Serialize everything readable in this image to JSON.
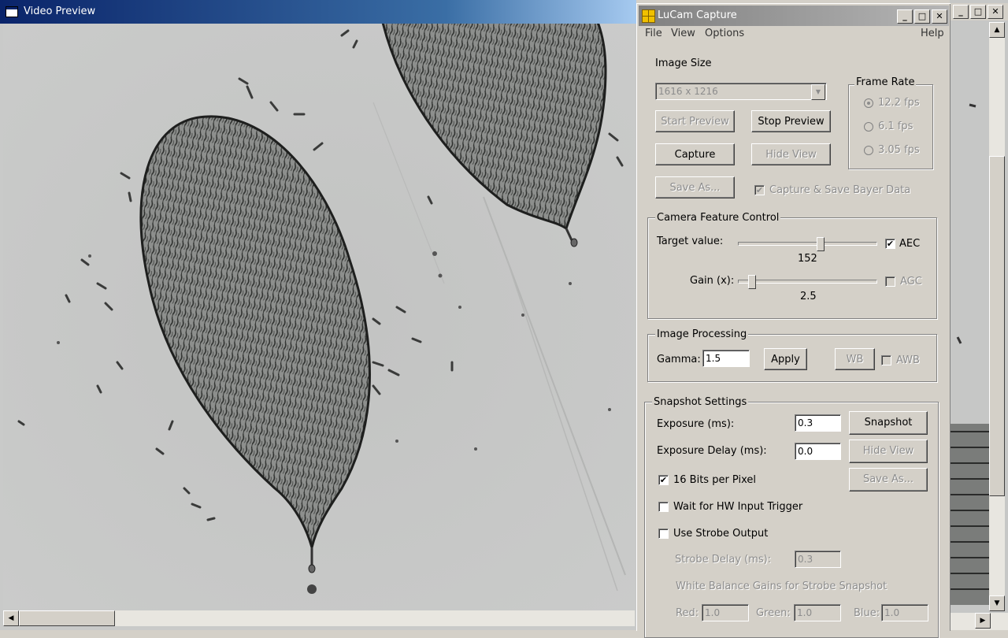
{
  "preview": {
    "title": "Video Preview"
  },
  "lucam": {
    "title": "LuCam Capture",
    "menu": {
      "file": "File",
      "view": "View",
      "options": "Options",
      "help": "Help"
    },
    "image_size": {
      "label": "Image Size",
      "selected": "1616 x 1216"
    },
    "frame_rate": {
      "title": "Frame Rate",
      "options": [
        "12.2 fps",
        "6.1 fps",
        "3.05 fps"
      ],
      "selected_index": 0
    },
    "buttons": {
      "start_preview": "Start Preview",
      "stop_preview": "Stop Preview",
      "capture": "Capture",
      "hide_view": "Hide View",
      "save_as": "Save As..."
    },
    "bayer": {
      "label": "Capture & Save Bayer Data",
      "checked": true
    },
    "camera_feature": {
      "title": "Camera Feature Control",
      "target_label": "Target value:",
      "target_value": "152",
      "target_fraction": 0.6,
      "aec_label": "AEC",
      "aec_checked": true,
      "gain_label": "Gain (x):",
      "gain_value": "2.5",
      "gain_fraction": 0.08,
      "agc_label": "AGC",
      "agc_checked": false
    },
    "image_processing": {
      "title": "Image Processing",
      "gamma_label": "Gamma:",
      "gamma_value": "1.5",
      "apply_label": "Apply",
      "wb_label": "WB",
      "awb_label": "AWB"
    },
    "snapshot": {
      "title": "Snapshot Settings",
      "exposure_label": "Exposure (ms):",
      "exposure_value": "0.3",
      "delay_label": "Exposure Delay (ms):",
      "delay_value": "0.0",
      "snapshot_button": "Snapshot",
      "hide_view_button": "Hide View",
      "save_as_button": "Save As...",
      "bits_label": "16 Bits per Pixel",
      "bits_checked": true,
      "hw_trigger_label": "Wait for HW Input Trigger",
      "strobe_label": "Use Strobe Output",
      "strobe_delay_label": "Strobe Delay (ms):",
      "strobe_delay_value": "0.3",
      "wb_gains_label": "White Balance Gains for Strobe Snapshot",
      "red_label": "Red:",
      "red_value": "1.0",
      "green_label": "Green:",
      "green_value": "1.0",
      "blue_label": "Blue:",
      "blue_value": "1.0"
    }
  }
}
